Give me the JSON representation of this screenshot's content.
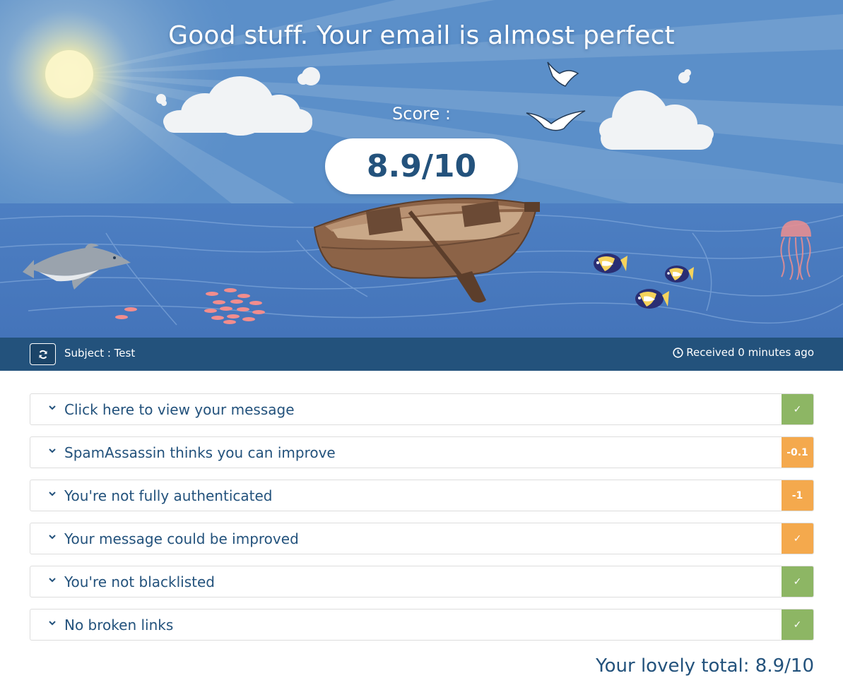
{
  "hero": {
    "headline": "Good stuff. Your email is almost perfect",
    "score_label": "Score :",
    "score_value": "8.9/10"
  },
  "infobar": {
    "refresh_icon": "refresh-icon",
    "subject": "Subject : Test",
    "clock_icon": "clock-icon",
    "received": "Received 0 minutes ago"
  },
  "checks": [
    {
      "label": "Click here to view your message",
      "badge": "✓",
      "status": "pass",
      "color": "#8db664"
    },
    {
      "label": "SpamAssassin thinks you can improve",
      "badge": "-0.1",
      "status": "warning",
      "color": "#f4a94d"
    },
    {
      "label": "You're not fully authenticated",
      "badge": "-1",
      "status": "warning",
      "color": "#f4a94d"
    },
    {
      "label": "Your message could be improved",
      "badge": "✓",
      "status": "warning",
      "color": "#f4a94d"
    },
    {
      "label": "You're not blacklisted",
      "badge": "✓",
      "status": "pass",
      "color": "#8db664"
    },
    {
      "label": "No broken links",
      "badge": "✓",
      "status": "pass",
      "color": "#8db664"
    }
  ],
  "total": "Your lovely total: 8.9/10",
  "colors": {
    "brand": "#23527c",
    "pass": "#8db664",
    "warning": "#f4a94d",
    "sky": "#5b8fc9",
    "sea": "#4677bd"
  }
}
